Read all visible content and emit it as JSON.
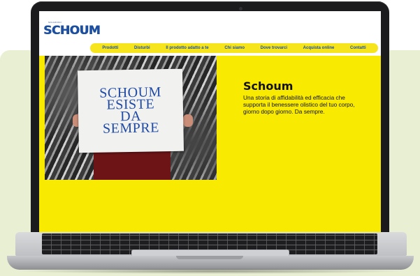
{
  "brand": {
    "tagline": "SOLUZIONI",
    "logo": "SCHOUM"
  },
  "nav": {
    "items": [
      "Prodotti",
      "Disturbi",
      "Il prodotto adatto a te",
      "Chi siamo",
      "Dove trovarci",
      "Acquista online",
      "Contatti"
    ]
  },
  "hero": {
    "sign_text": "SCHOUM\nESISTE\nDA\nSEMPRE",
    "title": "Schoum",
    "description": "Una storia di affidabilità ed efficacia che supporta il benessere olistico del tuo corpo, giorno dopo giorno. Da sempre."
  },
  "colors": {
    "accent_yellow": "#f8ea00",
    "brand_blue": "#1d4fa0",
    "background_green": "#e9efd3"
  }
}
